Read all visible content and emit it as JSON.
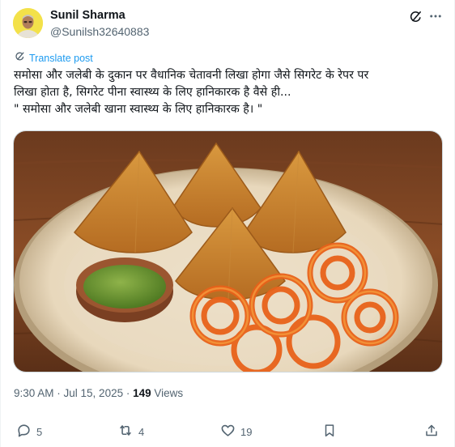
{
  "author": {
    "name": "Sunil Sharma",
    "handle": "@Sunilsh32640883"
  },
  "header_icons": [
    "grok-icon",
    "more-icon"
  ],
  "translate": {
    "label": "Translate post",
    "icon": "translate-icon"
  },
  "post": {
    "lines": [
      "समोसा और जलेबी के दुकान पर वैधानिक चेतावनी लिखा होगा जैसे सिगरेट के रेपर पर",
      "लिखा होता है, सिगरेट पीना स्वास्थ्य के लिए हानिकारक है वैसे ही...",
      "\" समोसा और जलेबी खाना स्वास्थ्य के लिए हानिकारक है। \""
    ]
  },
  "media": {
    "subject": "samosa-and-jalebi-photo"
  },
  "meta": {
    "time": "9:30 AM",
    "separator1": " · ",
    "date": "Jul 15, 2025",
    "separator2": " · ",
    "views_count": "149",
    "views_label": " Views"
  },
  "actions": {
    "reply_count": "5",
    "retweet_count": "4",
    "like_count": "19"
  },
  "colors": {
    "text": "#0f1419",
    "secondary": "#536471",
    "link": "#1d9bf0",
    "avatar_bg": "#f3e14a"
  }
}
